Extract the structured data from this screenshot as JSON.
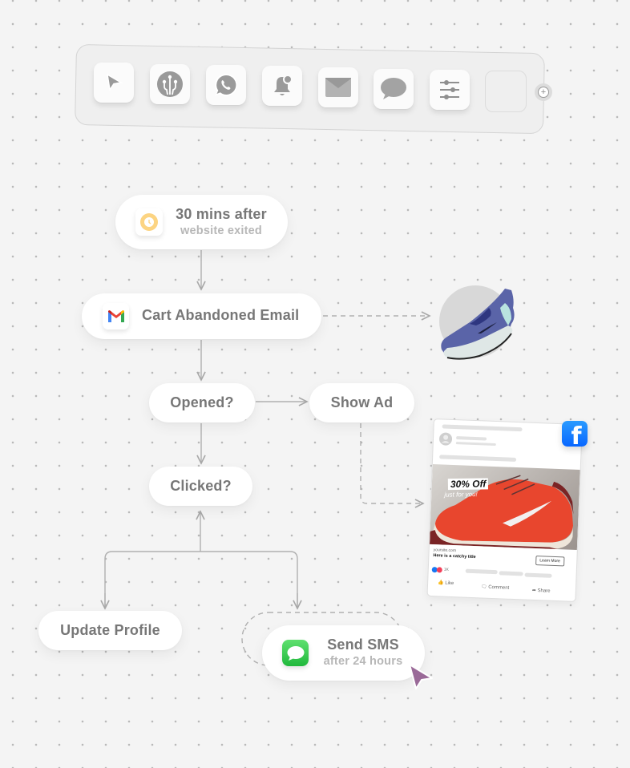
{
  "toolbar": {
    "tools": [
      {
        "name": "cursor-tool",
        "icon": "cursor-icon"
      },
      {
        "name": "integration-tool",
        "icon": "integration-icon"
      },
      {
        "name": "whatsapp-tool",
        "icon": "whatsapp-icon"
      },
      {
        "name": "notification-tool",
        "icon": "bell-icon"
      },
      {
        "name": "email-tool",
        "icon": "mail-icon"
      },
      {
        "name": "message-tool",
        "icon": "chat-bubble-icon"
      },
      {
        "name": "filter-tool",
        "icon": "sliders-icon"
      },
      {
        "name": "empty-slot",
        "icon": ""
      }
    ],
    "add_icon": "plus-circle-icon",
    "add_symbol": "+"
  },
  "flow": {
    "trigger": {
      "title": "30 mins after",
      "subtitle": "website exited",
      "icon": "clock-icon",
      "icon_color": "#fbd37e"
    },
    "email": {
      "title": "Cart Abandoned Email",
      "icon": "gmail-icon"
    },
    "opened": {
      "title": "Opened?"
    },
    "show_ad": {
      "title": "Show Ad"
    },
    "clicked": {
      "title": "Clicked?"
    },
    "update_profile": {
      "title": "Update Profile"
    },
    "send_sms": {
      "title": "Send SMS",
      "subtitle": "after 24 hours",
      "icon": "messages-icon",
      "icon_color": "#34c759"
    }
  },
  "ad_preview": {
    "platform_icon": "facebook-icon",
    "platform_letter": "f",
    "platform_color": "#0866ff",
    "promo_headline": "30% Off",
    "promo_sub": "just for you!",
    "site": "yoursite.com",
    "title": "Here is a catchy title",
    "cta": "Learn More",
    "reaction_count": "1K",
    "actions": [
      "Like",
      "Comment",
      "Share"
    ]
  },
  "cursor": {
    "color": "#9a6a98"
  }
}
